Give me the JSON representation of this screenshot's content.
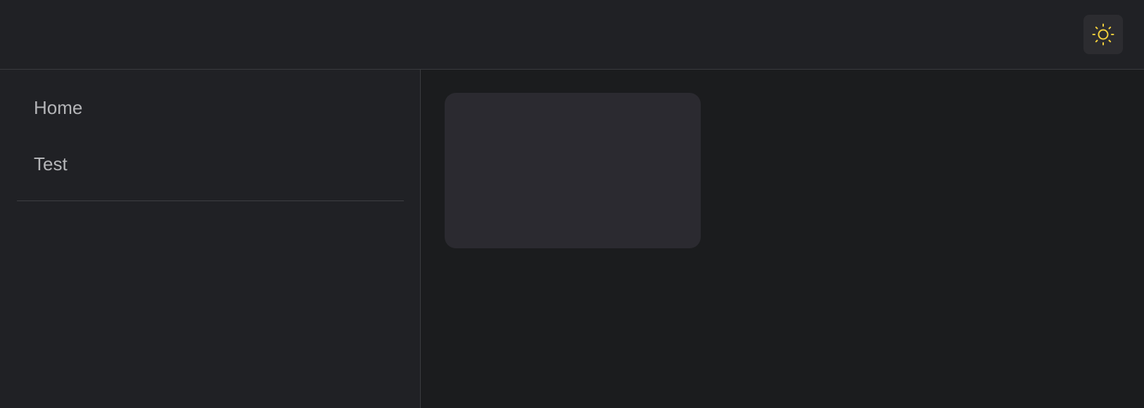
{
  "header": {
    "theme_toggle": {
      "icon": "sun-icon",
      "icon_color": "#f2cf3c"
    }
  },
  "sidebar": {
    "items": [
      {
        "label": "Home"
      },
      {
        "label": "Test"
      }
    ]
  },
  "main": {
    "cards": [
      {
        "content": ""
      }
    ]
  },
  "colors": {
    "header_bg": "#202125",
    "sidebar_bg": "#202125",
    "main_bg": "#1b1c1e",
    "card_bg": "#2b2a30",
    "divider": "#3a3b3f",
    "nav_text": "#b4b5b8",
    "accent": "#f2cf3c"
  }
}
